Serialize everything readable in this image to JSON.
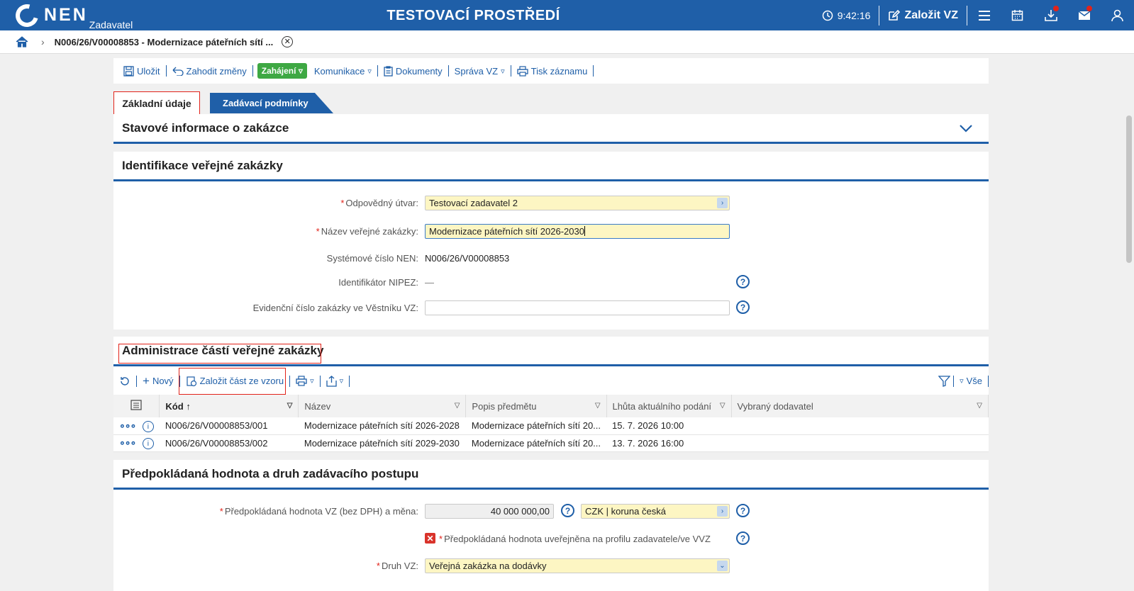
{
  "topbar": {
    "logo": "NEN",
    "logo_sub": "Zadavatel",
    "env_title": "TESTOVACÍ PROSTŘEDÍ",
    "clock": "9:42:16",
    "create_vz": "Založit VZ"
  },
  "breadcrumb": {
    "text": "N006/26/V00008853 - Modernizace páteřních sítí ..."
  },
  "toolbar": {
    "save": "Uložit",
    "discard": "Zahodit změny",
    "start": "Zahájení",
    "comm": "Komunikace",
    "docs": "Dokumenty",
    "manage": "Správa VZ",
    "print": "Tisk záznamu"
  },
  "tabs": {
    "basic": "Základní údaje",
    "conditions": "Zadávací podmínky"
  },
  "sections": {
    "status": "Stavové informace o zakázce",
    "ident": "Identifikace veřejné zakázky",
    "parts": "Administrace částí veřejné zakázky",
    "value": "Předpokládaná hodnota a druh zadávacího postupu"
  },
  "ident": {
    "unit_label": "Odpovědný útvar:",
    "unit_value": "Testovací zadavatel 2",
    "name_label": "Název veřejné zakázky:",
    "name_value": "Modernizace páteřních sítí 2026-2030",
    "sysnum_label": "Systémové číslo NEN:",
    "sysnum_value": "N006/26/V00008853",
    "nipez_label": "Identifikátor NIPEZ:",
    "nipez_value": "—",
    "evid_label": "Evidenční číslo zakázky ve Věstníku VZ:",
    "evid_value": ""
  },
  "grid": {
    "new": "Nový",
    "template": "Založit část ze vzoru",
    "all": "Vše",
    "columns": [
      "Kód",
      "Název",
      "Popis předmětu",
      "Lhůta aktuálního podání",
      "Vybraný dodavatel"
    ],
    "rows": [
      {
        "code": "N006/26/V00008853/001",
        "name": "Modernizace páteřních sítí 2026-2028",
        "desc": "Modernizace páteřních sítí 20...",
        "deadline": "15. 7. 2026 10:00",
        "supplier": ""
      },
      {
        "code": "N006/26/V00008853/002",
        "name": "Modernizace páteřních sítí 2029-2030",
        "desc": "Modernizace páteřních sítí 20...",
        "deadline": "13. 7. 2026 16:00",
        "supplier": ""
      }
    ]
  },
  "value": {
    "amount_label": "Předpokládaná hodnota VZ (bez DPH) a měna:",
    "amount_value": "40 000 000,00",
    "currency": "CZK | koruna česká",
    "published_label": "Předpokládaná hodnota uveřejněna na profilu zadavatele/ve VVZ",
    "kind_label": "Druh VZ:",
    "kind_value": "Veřejná zakázka na dodávky"
  },
  "colors": {
    "brand": "#1f5fa8",
    "green": "#3ea843",
    "required": "#e2231a",
    "field_yellow": "#fdf6c3"
  }
}
